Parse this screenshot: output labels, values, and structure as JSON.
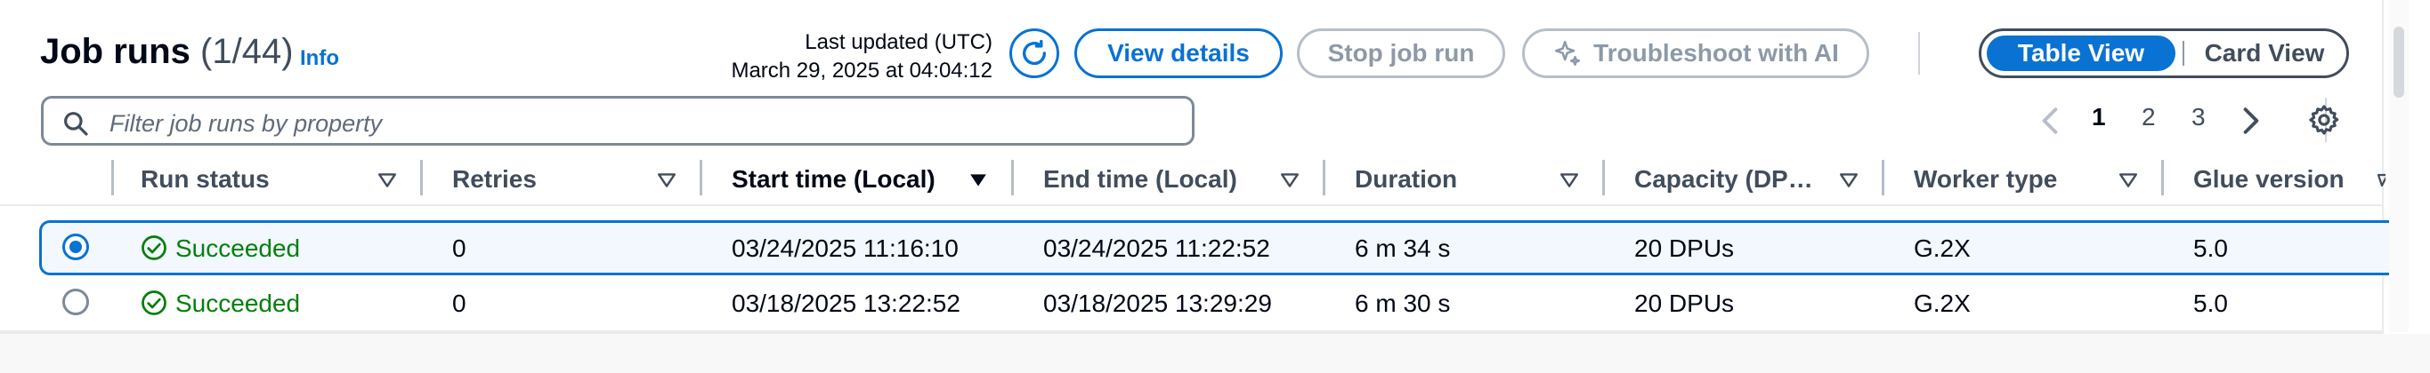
{
  "header": {
    "title": "Job runs",
    "count": "(1/44)",
    "info": "Info",
    "last_updated_label": "Last updated (UTC)",
    "last_updated_value": "March 29, 2025 at 04:04:12"
  },
  "toolbar": {
    "refresh_icon": "refresh-icon",
    "view_details": "View details",
    "stop_job_run": "Stop job run",
    "troubleshoot": "Troubleshoot with AI",
    "table_view": "Table View",
    "card_view": "Card View"
  },
  "filter": {
    "placeholder": "Filter job runs by property",
    "value": ""
  },
  "pagination": {
    "pages": [
      "1",
      "2",
      "3"
    ],
    "current": "1"
  },
  "table": {
    "columns": [
      "Run status",
      "Retries",
      "Start time (Local)",
      "End time (Local)",
      "Duration",
      "Capacity (DP…",
      "Worker type",
      "Glue version"
    ],
    "rows": [
      {
        "selected": true,
        "status": "Succeeded",
        "retries": "0",
        "start": "03/24/2025 11:16:10",
        "end": "03/24/2025 11:22:52",
        "duration": "6 m 34 s",
        "capacity": "20 DPUs",
        "worker": "G.2X",
        "glue": "5.0"
      },
      {
        "selected": false,
        "status": "Succeeded",
        "retries": "0",
        "start": "03/18/2025 13:22:52",
        "end": "03/18/2025 13:29:29",
        "duration": "6 m 30 s",
        "capacity": "20 DPUs",
        "worker": "G.2X",
        "glue": "5.0"
      }
    ]
  },
  "colors": {
    "accent": "#0972d3",
    "success": "#037f0c",
    "disabled": "#8d99a8"
  }
}
